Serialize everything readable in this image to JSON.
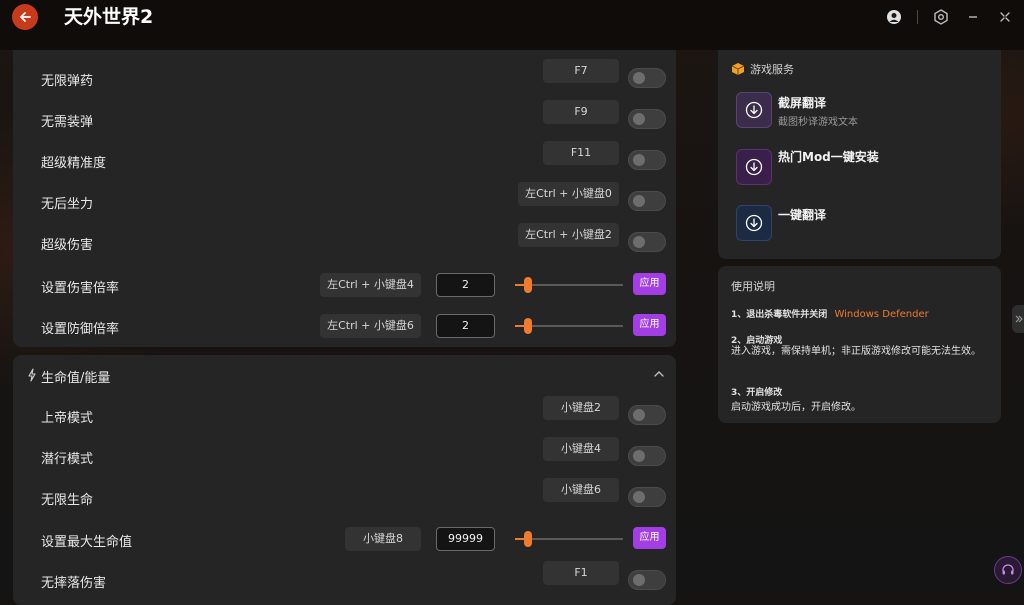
{
  "app": {
    "title": "天外世界2"
  },
  "icons": {
    "back": "back-arrow-icon",
    "user": "user-icon",
    "settings": "settings-icon",
    "minimize": "minimize-icon",
    "close": "close-icon",
    "lightning": "lightning-icon",
    "chevron": "chevron-up-icon",
    "box": "box-icon",
    "download": "download-icon",
    "headset": "headset-icon",
    "expand": "double-chevron-right-icon"
  },
  "colors": {
    "accent_orange": "#f07a2e",
    "apply_purple": "#a23ee3",
    "back_red": "#c83a1c"
  },
  "ammo_rows": [
    {
      "label": "无限弹药",
      "hotkey": "F7"
    },
    {
      "label": "无需装弹",
      "hotkey": "F9"
    },
    {
      "label": "超级精准度",
      "hotkey": "F11"
    },
    {
      "label": "无后坐力",
      "hotkey": "左Ctrl + 小键盘0"
    },
    {
      "label": "超级伤害",
      "hotkey": "左Ctrl + 小键盘2"
    }
  ],
  "ammo_sliders": [
    {
      "label": "设置伤害倍率",
      "hotkey": "左Ctrl + 小键盘4",
      "value": "2",
      "apply": "应用",
      "level": 0.08
    },
    {
      "label": "设置防御倍率",
      "hotkey": "左Ctrl + 小键盘6",
      "value": "2",
      "apply": "应用",
      "level": 0.08
    }
  ],
  "health_section": {
    "title": "生命值/能量",
    "rows": [
      {
        "label": "上帝模式",
        "hotkey": "小键盘2"
      },
      {
        "label": "潜行模式",
        "hotkey": "小键盘4"
      },
      {
        "label": "无限生命",
        "hotkey": "小键盘6"
      }
    ],
    "slider": {
      "label": "设置最大生命值",
      "hotkey": "小键盘8",
      "value": "99999",
      "apply": "应用",
      "level": 0.08
    },
    "rows2": [
      {
        "label": "无摔落伤害",
        "hotkey": "F1"
      }
    ]
  },
  "services": {
    "title": "游戏服务",
    "items": [
      {
        "title": "截屏翻译",
        "subtitle": "截图秒译游戏文本"
      },
      {
        "title": "热门Mod一键安装",
        "subtitle": ""
      },
      {
        "title": "一键翻译",
        "subtitle": ""
      }
    ]
  },
  "guide": {
    "title": "使用说明",
    "step1_title": "1、退出杀毒软件并关闭",
    "step1_highlight": "Windows Defender",
    "step2_title": "2、启动游戏",
    "step2_text": "进入游戏，需保持单机；非正版游戏修改可能无法生效。",
    "step3_title": "3、开启修改",
    "step3_text": "启动游戏成功后，开启修改。"
  }
}
